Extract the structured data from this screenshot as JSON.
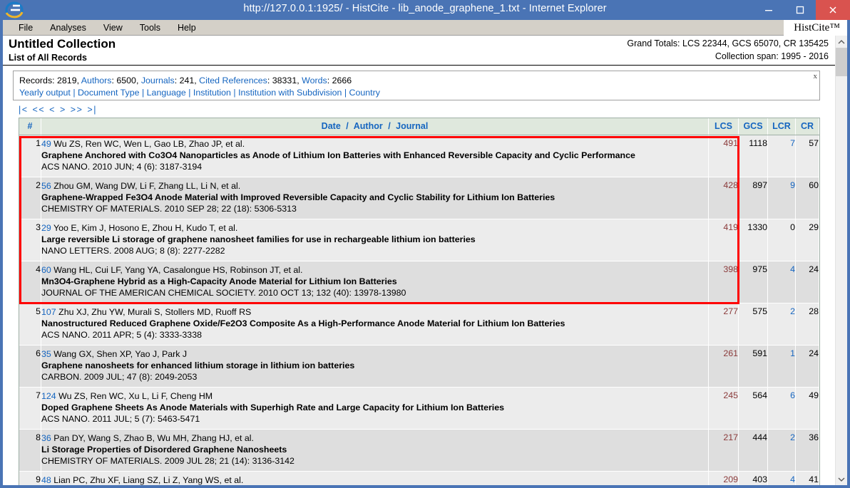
{
  "window": {
    "title": "http://127.0.0.1:1925/ - HistCite - lib_anode_graphene_1.txt - Internet Explorer",
    "minimize_label": "–",
    "maximize_label": "☐",
    "close_label": "×"
  },
  "menu": {
    "items": [
      "File",
      "Analyses",
      "View",
      "Tools",
      "Help"
    ],
    "brand": "HistCite™"
  },
  "header": {
    "collection_title": "Untitled Collection",
    "list_subtitle": "List of All Records",
    "grand_totals": "Grand Totals: LCS 22344, GCS 65070, CR 135425",
    "collection_span": "Collection span: 1995 - 2016"
  },
  "info_panel": {
    "close_label": "x",
    "stats": [
      {
        "label": "Records",
        "value": "2819",
        "label_link": false
      },
      {
        "label": "Authors",
        "value": "6500",
        "label_link": true
      },
      {
        "label": "Journals",
        "value": "241",
        "label_link": true
      },
      {
        "label": "Cited References",
        "value": "38331",
        "label_link": true
      },
      {
        "label": "Words",
        "value": "2666",
        "label_link": true
      }
    ],
    "links": [
      "Yearly output",
      "Document Type",
      "Language",
      "Institution",
      "Institution with Subdivision",
      "Country"
    ]
  },
  "pager": {
    "buttons": [
      "|<",
      "<<",
      "<",
      ">",
      ">>",
      ">|"
    ]
  },
  "table": {
    "headers": {
      "num": "#",
      "main_parts": [
        "Date",
        "Author",
        "Journal"
      ],
      "main_sep": "/",
      "lcs": "LCS",
      "gcs": "GCS",
      "lcr": "LCR",
      "cr": "CR"
    },
    "rows": [
      {
        "num": "1",
        "rank": "49",
        "authors": "Wu ZS, Ren WC, Wen L, Gao LB, Zhao JP, et al.",
        "title": "Graphene Anchored with Co3O4 Nanoparticles as Anode of Lithium Ion Batteries with Enhanced Reversible Capacity and Cyclic Performance",
        "journal": "ACS NANO. 2010 JUN; 4 (6): 3187-3194",
        "lcs": "491",
        "gcs": "1118",
        "lcr": "7",
        "cr": "57"
      },
      {
        "num": "2",
        "rank": "56",
        "authors": "Zhou GM, Wang DW, Li F, Zhang LL, Li N, et al.",
        "title": "Graphene-Wrapped Fe3O4 Anode Material with Improved Reversible Capacity and Cyclic Stability for Lithium Ion Batteries",
        "journal": "CHEMISTRY OF MATERIALS. 2010 SEP 28; 22 (18): 5306-5313",
        "lcs": "428",
        "gcs": "897",
        "lcr": "9",
        "cr": "60"
      },
      {
        "num": "3",
        "rank": "29",
        "authors": "Yoo E, Kim J, Hosono E, Zhou H, Kudo T, et al.",
        "title": "Large reversible Li storage of graphene nanosheet families for use in rechargeable lithium ion batteries",
        "journal": "NANO LETTERS. 2008 AUG; 8 (8): 2277-2282",
        "lcs": "419",
        "gcs": "1330",
        "lcr": "0",
        "cr": "29"
      },
      {
        "num": "4",
        "rank": "60",
        "authors": "Wang HL, Cui LF, Yang YA, Casalongue HS, Robinson JT, et al.",
        "title": "Mn3O4-Graphene Hybrid as a High-Capacity Anode Material for Lithium Ion Batteries",
        "journal": "JOURNAL OF THE AMERICAN CHEMICAL SOCIETY. 2010 OCT 13; 132 (40): 13978-13980",
        "lcs": "398",
        "gcs": "975",
        "lcr": "4",
        "cr": "24"
      },
      {
        "num": "5",
        "rank": "107",
        "authors": "Zhu XJ, Zhu YW, Murali S, Stollers MD, Ruoff RS",
        "title": "Nanostructured Reduced Graphene Oxide/Fe2O3 Composite As a High-Performance Anode Material for Lithium Ion Batteries",
        "journal": "ACS NANO. 2011 APR; 5 (4): 3333-3338",
        "lcs": "277",
        "gcs": "575",
        "lcr": "2",
        "cr": "28"
      },
      {
        "num": "6",
        "rank": "35",
        "authors": "Wang GX, Shen XP, Yao J, Park J",
        "title": "Graphene nanosheets for enhanced lithium storage in lithium ion batteries",
        "journal": "CARBON. 2009 JUL; 47 (8): 2049-2053",
        "lcs": "261",
        "gcs": "591",
        "lcr": "1",
        "cr": "24"
      },
      {
        "num": "7",
        "rank": "124",
        "authors": "Wu ZS, Ren WC, Xu L, Li F, Cheng HM",
        "title": "Doped Graphene Sheets As Anode Materials with Superhigh Rate and Large Capacity for Lithium Ion Batteries",
        "journal": "ACS NANO. 2011 JUL; 5 (7): 5463-5471",
        "lcs": "245",
        "gcs": "564",
        "lcr": "6",
        "cr": "49"
      },
      {
        "num": "8",
        "rank": "36",
        "authors": "Pan DY, Wang S, Zhao B, Wu MH, Zhang HJ, et al.",
        "title": "Li Storage Properties of Disordered Graphene Nanosheets",
        "journal": "CHEMISTRY OF MATERIALS. 2009 JUL 28; 21 (14): 3136-3142",
        "lcs": "217",
        "gcs": "444",
        "lcr": "2",
        "cr": "36"
      },
      {
        "num": "9",
        "rank": "48",
        "authors": "Lian PC, Zhu XF, Liang SZ, Li Z, Yang WS, et al.",
        "title": "",
        "journal": "",
        "lcs": "209",
        "gcs": "403",
        "lcr": "4",
        "cr": "41"
      }
    ]
  },
  "highlight": {
    "note": "red rectangle around rows 1-4 through LCS column"
  },
  "colors": {
    "titlebar": "#4a74b5",
    "close_button": "#d9534f",
    "link": "#1565c0",
    "lcs_text": "#8a3a3a",
    "header_bg": "#dfe8dd",
    "highlight_border": "#ff0000"
  },
  "scrollbar": {
    "up_arrow": "⌃",
    "down_arrow": "⌄"
  }
}
